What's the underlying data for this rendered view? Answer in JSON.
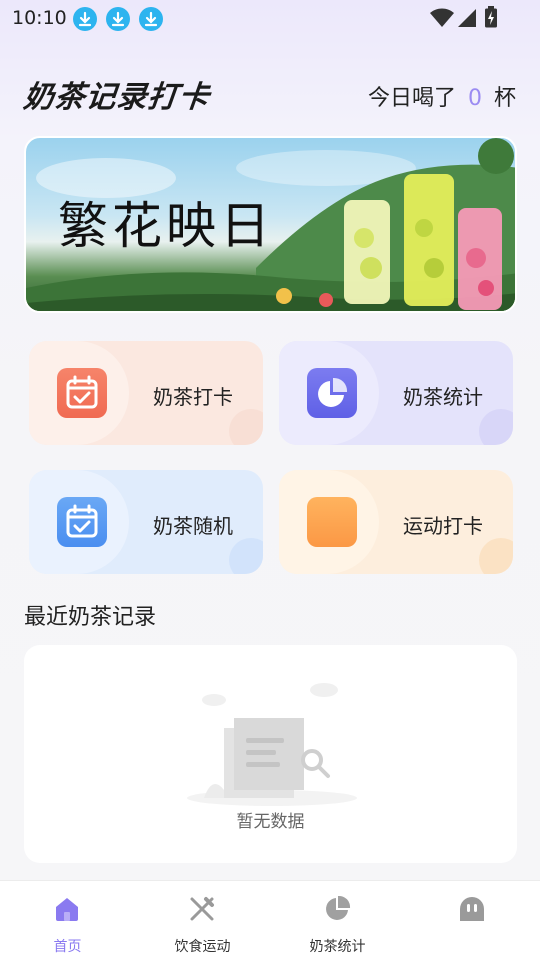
{
  "status_bar": {
    "time": "10:10",
    "notifications": [
      "download-icon",
      "download-icon",
      "download-icon"
    ],
    "system_icons": [
      "wifi-icon",
      "signal-icon",
      "battery-charging-icon"
    ]
  },
  "header": {
    "app_title": "奶茶记录打卡",
    "today_prefix": "今日喝了",
    "today_count": "0",
    "today_unit": "杯"
  },
  "banner": {
    "text": "繁花映日"
  },
  "tiles": [
    {
      "label": "奶茶打卡",
      "icon": "calendar-check-icon",
      "color": "#f06a52"
    },
    {
      "label": "奶茶统计",
      "icon": "pie-chart-icon",
      "color": "#5f60e6"
    },
    {
      "label": "奶茶随机",
      "icon": "calendar-check-icon",
      "color": "#4a8ef0"
    },
    {
      "label": "运动打卡",
      "icon": "square-icon",
      "color": "#fb9845"
    }
  ],
  "recent": {
    "title": "最近奶茶记录",
    "empty_text": "暂无数据"
  },
  "nav": {
    "items": [
      {
        "label": "首页",
        "icon": "home-icon",
        "active": true
      },
      {
        "label": "饮食运动",
        "icon": "fork-knife-icon",
        "active": false
      },
      {
        "label": "奶茶统计",
        "icon": "pie-chart-icon",
        "active": false
      },
      {
        "label": "",
        "icon": "profile-icon",
        "active": false
      }
    ]
  },
  "colors": {
    "accent": "#8a7af0",
    "count": "#9b8bf2"
  }
}
